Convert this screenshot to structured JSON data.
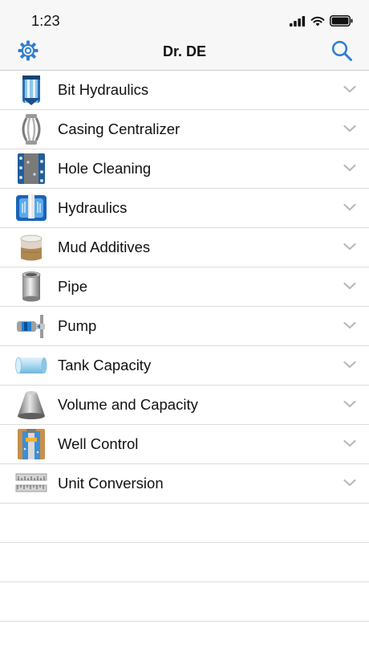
{
  "status_bar": {
    "time": "1:23"
  },
  "nav": {
    "title": "Dr. DE"
  },
  "menu": [
    {
      "label": "Bit Hydraulics",
      "icon": "bit-hydraulics-icon"
    },
    {
      "label": "Casing Centralizer",
      "icon": "casing-centralizer-icon"
    },
    {
      "label": "Hole Cleaning",
      "icon": "hole-cleaning-icon"
    },
    {
      "label": "Hydraulics",
      "icon": "hydraulics-icon"
    },
    {
      "label": "Mud Additives",
      "icon": "mud-additives-icon"
    },
    {
      "label": "Pipe",
      "icon": "pipe-icon"
    },
    {
      "label": "Pump",
      "icon": "pump-icon"
    },
    {
      "label": "Tank Capacity",
      "icon": "tank-capacity-icon"
    },
    {
      "label": "Volume and Capacity",
      "icon": "volume-capacity-icon"
    },
    {
      "label": "Well Control",
      "icon": "well-control-icon"
    },
    {
      "label": "Unit Conversion",
      "icon": "unit-conversion-icon"
    }
  ],
  "colors": {
    "accent": "#2f7fd1",
    "chevron": "#b8b8bd",
    "separator": "#dcdcdf"
  }
}
